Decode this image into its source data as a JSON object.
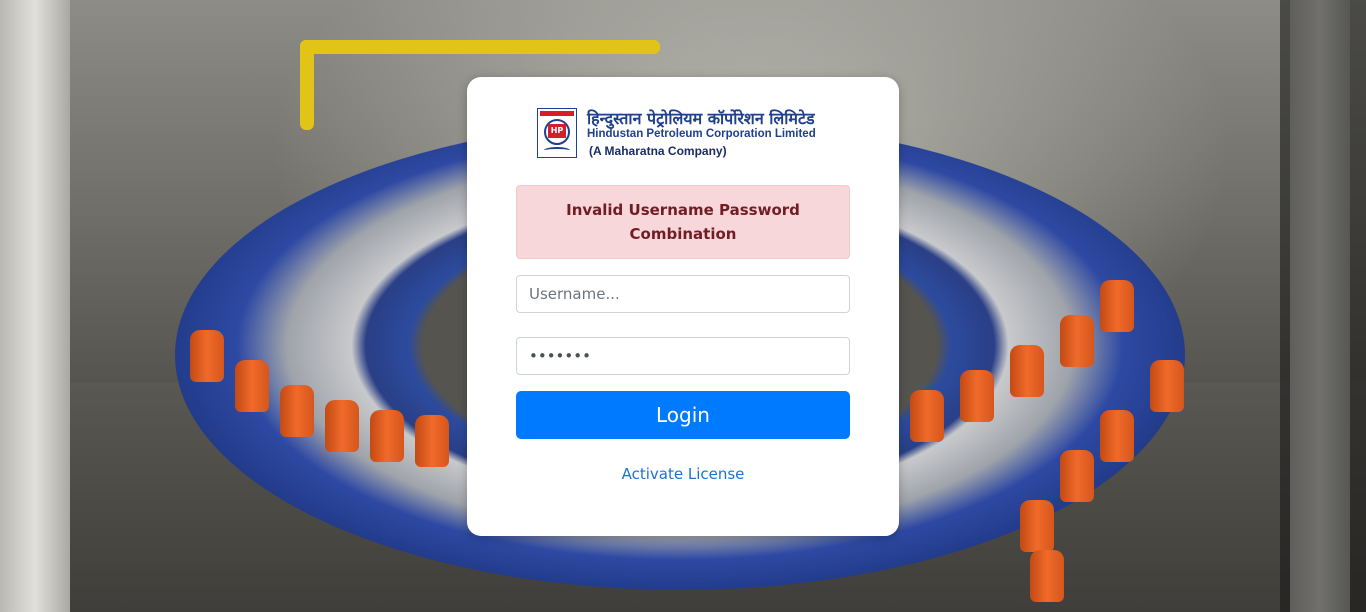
{
  "logo": {
    "emblem_text": "HP",
    "hindi_name": "हिन्दुस्तान पेट्रोलियम कॉर्पोरेशन लिमिटेड",
    "english_name": "Hindustan Petroleum Corporation Limited",
    "tagline": "(A Maharatna Company)"
  },
  "login": {
    "error_message": "Invalid Username Password Combination",
    "username_placeholder": "Username...",
    "password_value": "*******",
    "login_button": "Login",
    "activate_link": "Activate License"
  },
  "colors": {
    "primary_button": "#007bff",
    "alert_background": "#f8d7da",
    "alert_text": "#721c24",
    "link": "#1a73d1",
    "brand_blue": "#1f3f8f",
    "brand_red": "#d21f2b"
  }
}
